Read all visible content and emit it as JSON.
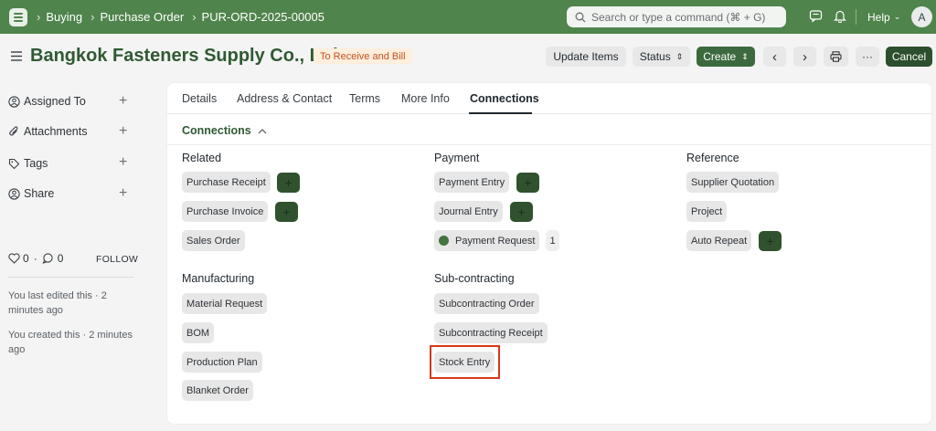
{
  "navbar": {
    "breadcrumbs": [
      "Buying",
      "Purchase Order",
      "PUR-ORD-2025-00005"
    ],
    "search_placeholder": "Search or type a command (⌘ + G)",
    "help_label": "Help",
    "avatar_initial": "A"
  },
  "header": {
    "title": "Bangkok Fasteners Supply Co., Ltd.",
    "status_badge": "To Receive and Bill",
    "buttons": {
      "update_items": "Update Items",
      "status": "Status",
      "create": "Create",
      "more": "···",
      "cancel": "Cancel"
    }
  },
  "sidebar": {
    "items": [
      {
        "label": "Assigned To"
      },
      {
        "label": "Attachments"
      },
      {
        "label": "Tags"
      },
      {
        "label": "Share"
      }
    ],
    "likes": "0",
    "comments": "0",
    "follow": "FOLLOW",
    "edited_note": "You last edited this · 2 minutes ago",
    "created_note": "You created this · 2 minutes ago"
  },
  "tabs": [
    "Details",
    "Address & Contact",
    "Terms",
    "More Info",
    "Connections"
  ],
  "active_tab": "Connections",
  "connections": {
    "title": "Connections",
    "groups": {
      "related": {
        "title": "Related",
        "items": [
          "Purchase Receipt",
          "Purchase Invoice",
          "Sales Order"
        ]
      },
      "payment": {
        "title": "Payment",
        "items": [
          "Payment Entry",
          "Journal Entry",
          "Payment Request"
        ],
        "payment_request_count": "1"
      },
      "reference": {
        "title": "Reference",
        "items": [
          "Supplier Quotation",
          "Project",
          "Auto Repeat"
        ]
      },
      "manufacturing": {
        "title": "Manufacturing",
        "items": [
          "Material Request",
          "BOM",
          "Production Plan",
          "Blanket Order"
        ]
      },
      "subcontracting": {
        "title": "Sub-contracting",
        "items": [
          "Subcontracting Order",
          "Subcontracting Receipt",
          "Stock Entry"
        ]
      }
    },
    "add_label": "+"
  },
  "colors": {
    "navbar": "#50844d",
    "title": "#2f5a32",
    "primary_button": "#3c6a3e",
    "add_button": "#30522e",
    "highlight": "#d9371c",
    "badge_bg": "#fdeede",
    "badge_text": "#c5531e"
  }
}
